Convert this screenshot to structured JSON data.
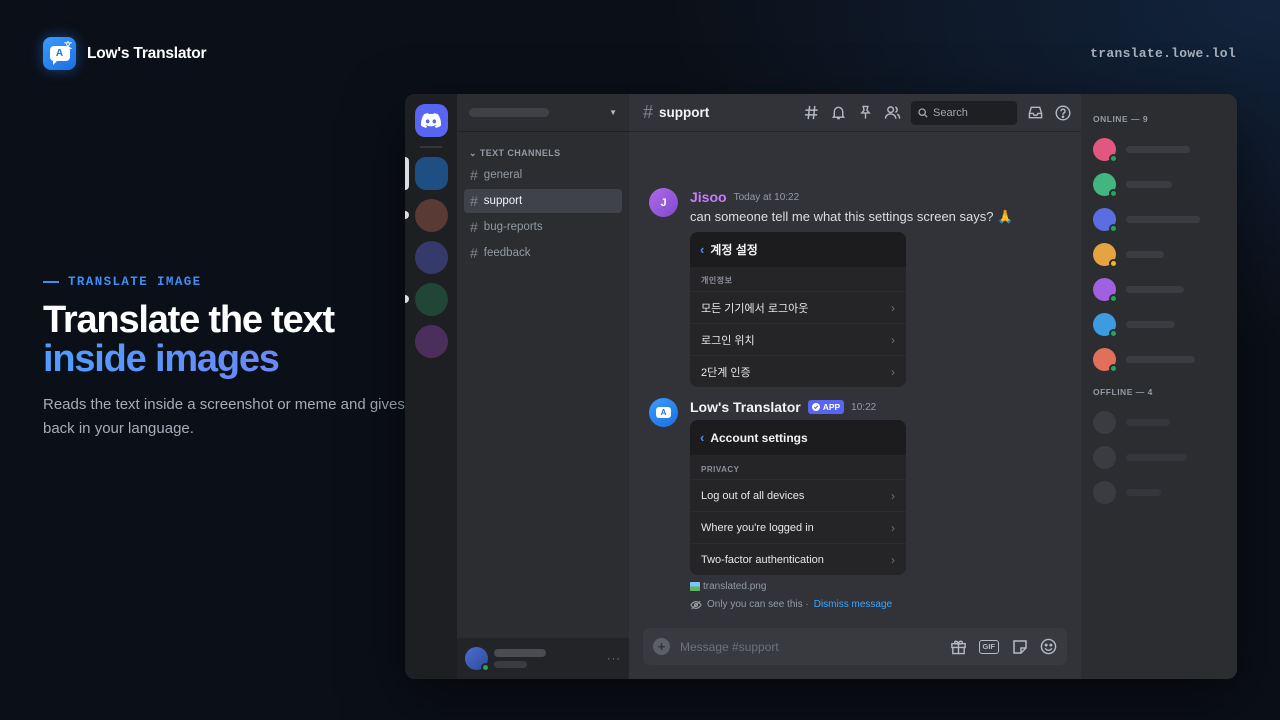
{
  "brand": {
    "name": "Low's Translator",
    "logo_glyph": "A",
    "logo_glyph2": "文",
    "url": "translate.lowe.lol"
  },
  "hero": {
    "eyebrow": "TRANSLATE IMAGE",
    "title_line1": "Translate the text",
    "title_line2": "inside images",
    "subtitle": "Reads the text inside a screenshot or meme and gives it back in your language."
  },
  "discord": {
    "channels": {
      "category": "TEXT CHANNELS",
      "items": [
        "general",
        "support",
        "bug-reports",
        "feedback"
      ],
      "active": "support"
    },
    "topbar": {
      "hash": "#",
      "title": "support",
      "search_placeholder": "Search"
    },
    "messages": [
      {
        "author": "Jisoo",
        "avatar_letter": "J",
        "time": "Today at 10:22",
        "text": "can someone tell me what this settings screen says? 🙏",
        "card": {
          "title": "계정 설정",
          "section": "개인정보",
          "rows": [
            "모든 기기에서 로그아웃",
            "로그인 위치",
            "2단계 인증"
          ]
        }
      },
      {
        "author": "Low's Translator",
        "badge": "APP",
        "time": "10:22",
        "card": {
          "title": "Account settings",
          "section": "PRIVACY",
          "rows": [
            "Log out of all devices",
            "Where you're logged in",
            "Two-factor authentication"
          ]
        },
        "attachment": "translated.png",
        "ephemeral_text": "Only you can see this ·",
        "dismiss_label": "Dismiss message"
      }
    ],
    "composer": {
      "placeholder": "Message #support",
      "gif_label": "GIF"
    },
    "members": {
      "online_header": "ONLINE — 9",
      "offline_header": "OFFLINE — 4"
    },
    "colors": {
      "accent": "#5865f2",
      "online": "#23a55a",
      "idle": "#f0b232",
      "link": "#3ea6ff"
    }
  }
}
